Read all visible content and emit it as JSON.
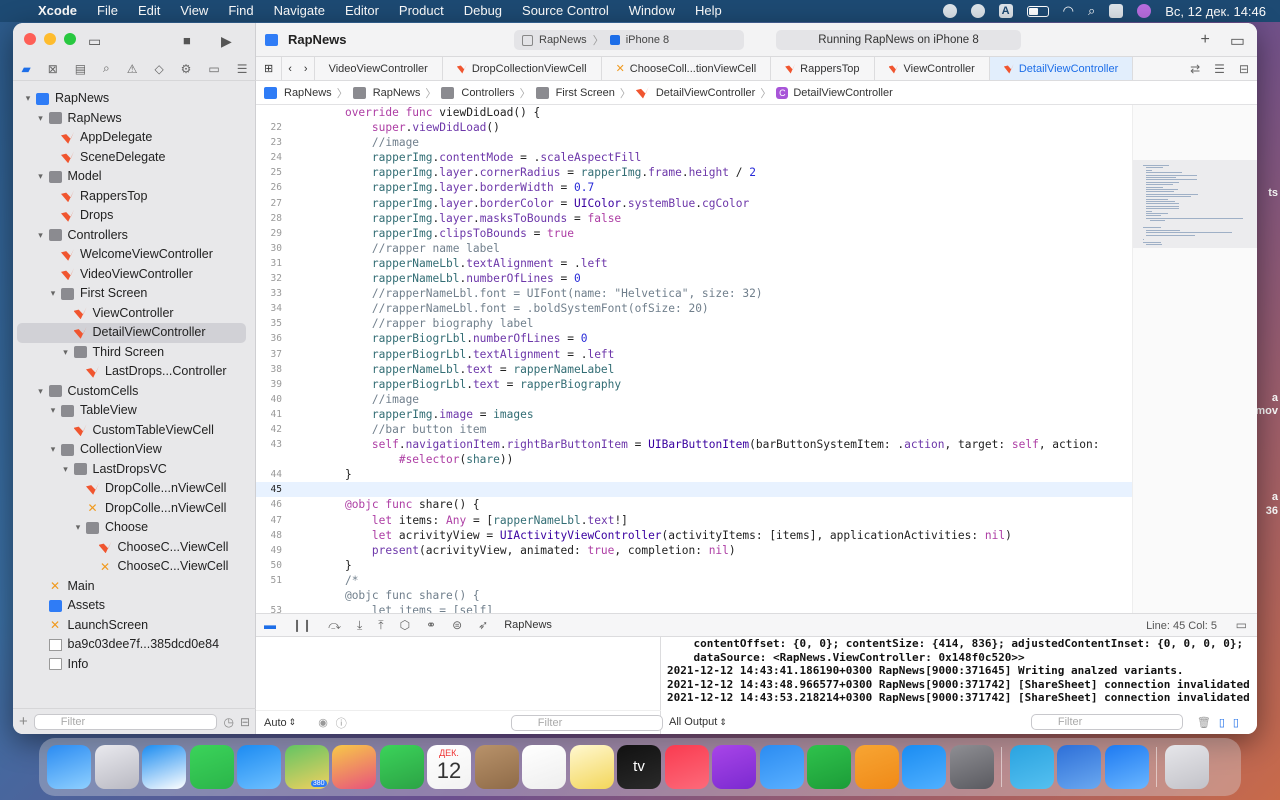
{
  "menubar": {
    "app": "Xcode",
    "items": [
      "File",
      "Edit",
      "View",
      "Find",
      "Navigate",
      "Editor",
      "Product",
      "Debug",
      "Source Control",
      "Window",
      "Help"
    ],
    "clock": "Вс, 12 дек.  14:46",
    "status_icon_text": "A"
  },
  "toolbar": {
    "project": "RapNews",
    "scheme": "RapNews",
    "destination": "iPhone 8",
    "status": "Running RapNews on iPhone 8"
  },
  "tabs": [
    "VideoViewController",
    "DropCollectionViewCell",
    "ChooseColl...tionViewCell",
    "RappersTop",
    "ViewController",
    "DetailViewController"
  ],
  "breadcrumb": [
    "RapNews",
    "RapNews",
    "Controllers",
    "First Screen",
    "DetailViewController",
    "DetailViewController"
  ],
  "tree": [
    {
      "label": "RapNews",
      "indent": 0,
      "icon": "proj",
      "disc": "▾"
    },
    {
      "label": "RapNews",
      "indent": 1,
      "icon": "folder",
      "disc": "▾"
    },
    {
      "label": "AppDelegate",
      "indent": 2,
      "icon": "swift"
    },
    {
      "label": "SceneDelegate",
      "indent": 2,
      "icon": "swift"
    },
    {
      "label": "Model",
      "indent": 1,
      "icon": "folder",
      "disc": "▾"
    },
    {
      "label": "RappersTop",
      "indent": 2,
      "icon": "swift"
    },
    {
      "label": "Drops",
      "indent": 2,
      "icon": "swift"
    },
    {
      "label": "Controllers",
      "indent": 1,
      "icon": "folder",
      "disc": "▾"
    },
    {
      "label": "WelcomeViewController",
      "indent": 2,
      "icon": "swift"
    },
    {
      "label": "VideoViewController",
      "indent": 2,
      "icon": "swift"
    },
    {
      "label": "First Screen",
      "indent": 2,
      "icon": "folder",
      "disc": "▾"
    },
    {
      "label": "ViewController",
      "indent": 3,
      "icon": "swift"
    },
    {
      "label": "DetailViewController",
      "indent": 3,
      "icon": "swift",
      "selected": true
    },
    {
      "label": "Third Screen",
      "indent": 3,
      "icon": "folder",
      "disc": "▾"
    },
    {
      "label": "LastDrops...Controller",
      "indent": 4,
      "icon": "swift"
    },
    {
      "label": "CustomCells",
      "indent": 1,
      "icon": "folder",
      "disc": "▾"
    },
    {
      "label": "TableView",
      "indent": 2,
      "icon": "folder",
      "disc": "▾"
    },
    {
      "label": "CustomTableViewCell",
      "indent": 3,
      "icon": "swift"
    },
    {
      "label": "CollectionView",
      "indent": 2,
      "icon": "folder",
      "disc": "▾"
    },
    {
      "label": "LastDropsVC",
      "indent": 3,
      "icon": "folder",
      "disc": "▾"
    },
    {
      "label": "DropColle...nViewCell",
      "indent": 4,
      "icon": "swift"
    },
    {
      "label": "DropColle...nViewCell",
      "indent": 4,
      "icon": "xib"
    },
    {
      "label": "Choose",
      "indent": 4,
      "icon": "folder",
      "disc": "▾"
    },
    {
      "label": "ChooseC...ViewCell",
      "indent": 5,
      "icon": "swift"
    },
    {
      "label": "ChooseC...ViewCell",
      "indent": 5,
      "icon": "xib"
    },
    {
      "label": "Main",
      "indent": 1,
      "icon": "xib"
    },
    {
      "label": "Assets",
      "indent": 1,
      "icon": "assets"
    },
    {
      "label": "LaunchScreen",
      "indent": 1,
      "icon": "xib"
    },
    {
      "label": "ba9c03dee7f...385dcd0e84",
      "indent": 1,
      "icon": "file"
    },
    {
      "label": "Info",
      "indent": 1,
      "icon": "plist"
    }
  ],
  "code": [
    {
      "n": "",
      "h": "    <span class='kw'>override func</span> viewDidLoad() {"
    },
    {
      "n": "22",
      "h": "        <span class='kw'>super</span>.<span class='pr'>viewDidLoad</span>()"
    },
    {
      "n": "23",
      "h": "        <span class='cm'>//image</span>"
    },
    {
      "n": "24",
      "h": "        <span class='pl'>rapperImg</span>.<span class='pr'>contentMode</span> = .<span class='pr'>scaleAspectFill</span>"
    },
    {
      "n": "25",
      "h": "        <span class='pl'>rapperImg</span>.<span class='pr'>layer</span>.<span class='pr'>cornerRadius</span> = <span class='pl'>rapperImg</span>.<span class='pr'>frame</span>.<span class='pr'>height</span> / <span class='nm'>2</span>"
    },
    {
      "n": "26",
      "h": "        <span class='pl'>rapperImg</span>.<span class='pr'>layer</span>.<span class='pr'>borderWidth</span> = <span class='nm'>0.7</span>"
    },
    {
      "n": "27",
      "h": "        <span class='pl'>rapperImg</span>.<span class='pr'>layer</span>.<span class='pr'>borderColor</span> = <span class='ty'>UIColor</span>.<span class='pr'>systemBlue</span>.<span class='pr'>cgColor</span>"
    },
    {
      "n": "28",
      "h": "        <span class='pl'>rapperImg</span>.<span class='pr'>layer</span>.<span class='pr'>masksToBounds</span> = <span class='kw'>false</span>"
    },
    {
      "n": "29",
      "h": "        <span class='pl'>rapperImg</span>.<span class='pr'>clipsToBounds</span> = <span class='kw'>true</span>"
    },
    {
      "n": "30",
      "h": "        <span class='cm'>//rapper name label</span>"
    },
    {
      "n": "31",
      "h": "        <span class='pl'>rapperNameLbl</span>.<span class='pr'>textAlignment</span> = .<span class='pr'>left</span>"
    },
    {
      "n": "32",
      "h": "        <span class='pl'>rapperNameLbl</span>.<span class='pr'>numberOfLines</span> = <span class='nm'>0</span>"
    },
    {
      "n": "33",
      "h": "        <span class='cm'>//rapperNameLbl.font = UIFont(name: \"Helvetica\", size: 32)</span>"
    },
    {
      "n": "34",
      "h": "        <span class='cm'>//rapperNameLbl.font = .boldSystemFont(ofSize: 20)</span>"
    },
    {
      "n": "35",
      "h": "        <span class='cm'>//rapper biography label</span>"
    },
    {
      "n": "36",
      "h": "        <span class='pl'>rapperBiogrLbl</span>.<span class='pr'>numberOfLines</span> = <span class='nm'>0</span>"
    },
    {
      "n": "37",
      "h": "        <span class='pl'>rapperBiogrLbl</span>.<span class='pr'>textAlignment</span> = .<span class='pr'>left</span>"
    },
    {
      "n": "38",
      "h": "        <span class='pl'>rapperNameLbl</span>.<span class='pr'>text</span> = <span class='pl'>rapperNameLabel</span>"
    },
    {
      "n": "39",
      "h": "        <span class='pl'>rapperBiogrLbl</span>.<span class='pr'>text</span> = <span class='pl'>rapperBiography</span>"
    },
    {
      "n": "40",
      "h": "        <span class='cm'>//image</span>"
    },
    {
      "n": "41",
      "h": "        <span class='pl'>rapperImg</span>.<span class='pr'>image</span> = <span class='pl'>images</span>"
    },
    {
      "n": "42",
      "h": "        <span class='cm'>//bar button item</span>"
    },
    {
      "n": "43",
      "h": "        <span class='kw'>self</span>.<span class='pr'>navigationItem</span>.<span class='pr'>rightBarButtonItem</span> = <span class='ty'>UIBarButtonItem</span>(barButtonSystemItem: .<span class='pr'>action</span>, target: <span class='kw'>self</span>, action:"
    },
    {
      "n": "",
      "h": "            <span class='kw'>#selector</span>(<span class='pl'>share</span>))",
      "wrap": true
    },
    {
      "n": "44",
      "h": "    }"
    },
    {
      "n": "45",
      "h": "",
      "cur": true
    },
    {
      "n": "46",
      "h": "    <span class='kw'>@objc func</span> share() {"
    },
    {
      "n": "47",
      "h": "        <span class='kw'>let</span> items: <span class='kw'>Any</span> = [<span class='pl'>rapperNameLbl</span>.<span class='pr'>text</span>!]"
    },
    {
      "n": "48",
      "h": "        <span class='kw'>let</span> acrivityView = <span class='ty'>UIActivityViewController</span>(activityItems: [items], applicationActivities: <span class='kw'>nil</span>)"
    },
    {
      "n": "49",
      "h": "        <span class='pr'>present</span>(acrivityView, animated: <span class='kw'>true</span>, completion: <span class='kw'>nil</span>)"
    },
    {
      "n": "50",
      "h": "    }"
    },
    {
      "n": "51",
      "h": "    <span class='cm'>/*</span>"
    },
    {
      "n": "",
      "h": "    <span class='cm'>@objc func share() {</span>"
    },
    {
      "n": "53",
      "h": "        <span class='cm'>let items = [self]</span>"
    }
  ],
  "debug": {
    "process": "RapNews",
    "linecol": "Line: 45  Col: 5",
    "auto_label": "Auto",
    "output_label": "All Output",
    "filter_placeholder": "Filter"
  },
  "console": [
    "    contentOffset: {0, 0}; contentSize: {414, 836}; adjustedContentInset: {0, 0, 0, 0};",
    "    dataSource: <RapNews.ViewController: 0x148f0c520>>",
    "2021-12-12 14:43:41.186190+0300 RapNews[9000:371645] Writing analzed variants.",
    "2021-12-12 14:43:48.966577+0300 RapNews[9000:371742] [ShareSheet] connection invalidated",
    "2021-12-12 14:43:53.218214+0300 RapNews[9000:371742] [ShareSheet] connection invalidated"
  ],
  "edge_text": [
    "ts",
    "а",
    "mov",
    "а",
    "36"
  ],
  "dock": {
    "calendar_month": "ДЕК.",
    "calendar_day": "12",
    "tv_label": "tv",
    "badge": "380"
  },
  "dock_icons": [
    {
      "name": "finder-icon",
      "c1": "#2a8bf2",
      "c2": "#8fd0ff"
    },
    {
      "name": "launchpad-icon",
      "c1": "#e9e9ee",
      "c2": "#b9b9c2"
    },
    {
      "name": "safari-icon",
      "c1": "#1b8cf0",
      "c2": "#ffffff"
    },
    {
      "name": "messages-icon",
      "c1": "#3bd35a",
      "c2": "#2bb54a"
    },
    {
      "name": "mail-icon",
      "c1": "#1c8bf2",
      "c2": "#6ec0ff"
    },
    {
      "name": "maps-icon",
      "c1": "#62c462",
      "c2": "#f0d060"
    },
    {
      "name": "photos-icon",
      "c1": "#f7c948",
      "c2": "#e8527c"
    },
    {
      "name": "facetime-icon",
      "c1": "#3bd35a",
      "c2": "#2ca345"
    },
    {
      "name": "calendar-icon",
      "c1": "#ffffff",
      "c2": "#f2f2f2"
    },
    {
      "name": "contacts-icon",
      "c1": "#b8926a",
      "c2": "#8f6b48"
    },
    {
      "name": "reminders-icon",
      "c1": "#ffffff",
      "c2": "#eeeeee"
    },
    {
      "name": "notes-icon",
      "c1": "#fff8d0",
      "c2": "#f3d65a"
    },
    {
      "name": "appletv-icon",
      "c1": "#111111",
      "c2": "#2a2a2a"
    },
    {
      "name": "music-icon",
      "c1": "#fa3b50",
      "c2": "#fc6a7a"
    },
    {
      "name": "podcasts-icon",
      "c1": "#a845e8",
      "c2": "#7b2ad0"
    },
    {
      "name": "keynote-icon",
      "c1": "#2b8cf2",
      "c2": "#5ab0ff"
    },
    {
      "name": "numbers-icon",
      "c1": "#2fc24c",
      "c2": "#1c9c38"
    },
    {
      "name": "pages-icon",
      "c1": "#f7a533",
      "c2": "#f08a18"
    },
    {
      "name": "appstore-icon",
      "c1": "#1a8cf2",
      "c2": "#4fb0ff"
    },
    {
      "name": "system-preferences-icon",
      "c1": "#8e8e93",
      "c2": "#5a5a60"
    },
    {
      "name": "telegram-icon",
      "c1": "#2aa3e0",
      "c2": "#55c0f0"
    },
    {
      "name": "instruments-icon",
      "c1": "#2d6fd8",
      "c2": "#6aa8f0"
    },
    {
      "name": "xcode-icon",
      "c1": "#1d7af2",
      "c2": "#6ab6ff"
    },
    {
      "name": "trash-icon",
      "c1": "#e6e6ea",
      "c2": "#c2c2c8"
    }
  ]
}
